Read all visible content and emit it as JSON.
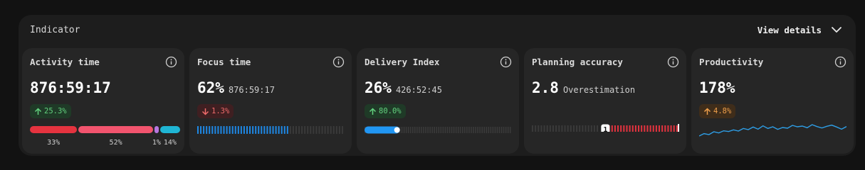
{
  "panel": {
    "title": "Indicator",
    "view_details_label": "View details"
  },
  "cards": {
    "activity": {
      "title": "Activity time",
      "value": "876:59:17",
      "badge": "25.3%",
      "trend": "up",
      "breakdown": [
        {
          "percent_label": "33%",
          "fraction": 0.33,
          "color": "#e5333f"
        },
        {
          "percent_label": "52%",
          "fraction": 0.52,
          "color": "#f2546e"
        },
        {
          "percent_label": "1%",
          "fraction": 0.01,
          "color": "#b777e0"
        },
        {
          "percent_label": "14%",
          "fraction": 0.14,
          "color": "#1fb5d4"
        }
      ]
    },
    "focus": {
      "title": "Focus time",
      "value": "62%",
      "subvalue": "876:59:17",
      "badge": "1.3%",
      "trend": "down",
      "progress": 0.62,
      "color": "#1e88e5"
    },
    "delivery": {
      "title": "Delivery Index",
      "value": "26%",
      "subvalue": "426:52:45",
      "badge": "80.0%",
      "trend": "up",
      "progress": 0.24,
      "color": "#2196f3"
    },
    "planning": {
      "title": "Planning accuracy",
      "value": "2.8",
      "subvalue": "Overestimation",
      "marker_label": "1",
      "color": "#e5333f"
    },
    "productivity": {
      "title": "Productivity",
      "value": "178%",
      "badge": "4.8%",
      "trend": "up",
      "color": "#2e9ee6",
      "sparkline": [
        3,
        4,
        3.6,
        4.8,
        4.3,
        5.2,
        4.9,
        5.6,
        5.1,
        6.2,
        5.7,
        6.8,
        5.9,
        7.3,
        6.2,
        6.9,
        5.8,
        6.6,
        6.3,
        7.5,
        6.9,
        7.2,
        6.5,
        7.8,
        7.0,
        6.4,
        7.1,
        7.6,
        6.8,
        5.9,
        7.0
      ]
    }
  },
  "icons": {
    "info": "info-icon",
    "chevron": "chevron-down-icon",
    "arrow_up": "arrow-up-icon",
    "arrow_down": "arrow-down-icon"
  }
}
